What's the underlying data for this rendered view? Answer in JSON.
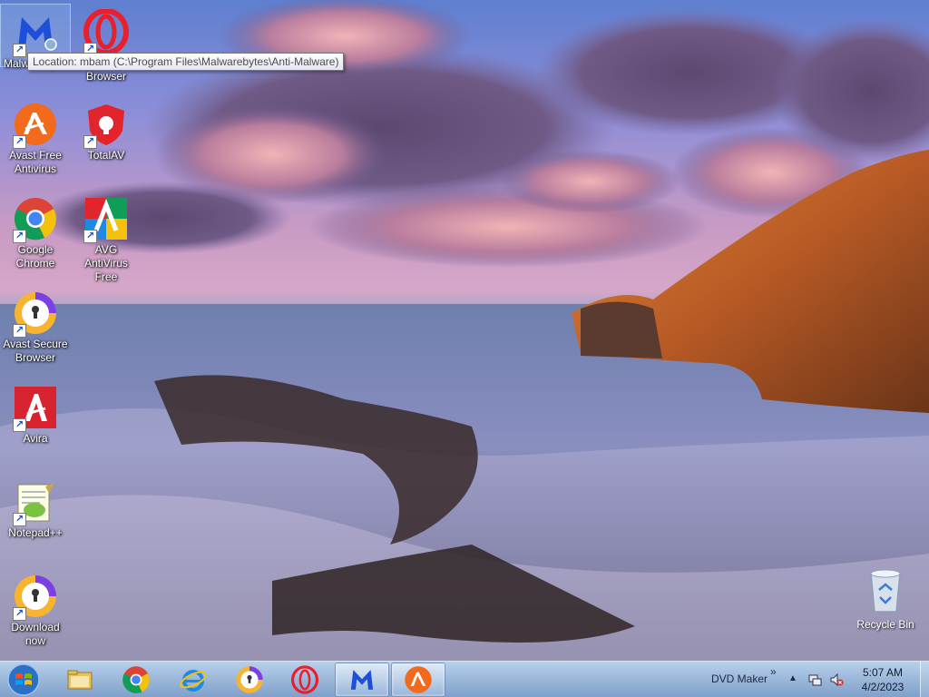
{
  "desktop": {
    "icons": [
      {
        "id": "malwarebytes",
        "label": "Malwarebytes",
        "icon": "malwarebytes-icon",
        "selected": true
      },
      {
        "id": "opera",
        "label": "Opera Browser",
        "icon": "opera-icon"
      },
      {
        "id": "avast-free",
        "label": "Avast Free Antivirus",
        "icon": "avast-icon"
      },
      {
        "id": "totalav",
        "label": "TotalAV",
        "icon": "totalav-icon"
      },
      {
        "id": "chrome",
        "label": "Google Chrome",
        "icon": "chrome-icon"
      },
      {
        "id": "avg",
        "label": "AVG AntiVirus Free",
        "icon": "avg-icon"
      },
      {
        "id": "avast-secure",
        "label": "Avast Secure Browser",
        "icon": "avast-secure-browser-icon"
      },
      {
        "id": "avira",
        "label": "Avira",
        "icon": "avira-icon"
      },
      {
        "id": "notepadpp",
        "label": "Notepad++",
        "icon": "notepadpp-icon"
      },
      {
        "id": "download",
        "label": "Download now",
        "icon": "download-now-icon"
      }
    ],
    "recycle_bin": {
      "label": "Recycle Bin",
      "icon": "recycle-bin-icon"
    },
    "tooltip": "Location: mbam (C:\\Program Files\\Malwarebytes\\Anti-Malware)",
    "shortcut_glyph": "↗"
  },
  "taskbar": {
    "start_icon": "windows-start-icon",
    "pinned": [
      {
        "id": "explorer",
        "icon": "file-explorer-icon"
      },
      {
        "id": "chrome",
        "icon": "chrome-icon"
      },
      {
        "id": "ie",
        "icon": "internet-explorer-icon"
      },
      {
        "id": "avast-secure",
        "icon": "avast-secure-browser-icon"
      },
      {
        "id": "opera",
        "icon": "opera-icon"
      },
      {
        "id": "malwarebytes",
        "icon": "malwarebytes-icon",
        "active": true
      },
      {
        "id": "avast",
        "icon": "avast-icon"
      }
    ],
    "toolbar_label": "DVD Maker",
    "toolbar_chevron": "»",
    "tray_arrow": "▲",
    "tray_icons": [
      "network-icon",
      "volume-muted-icon"
    ],
    "clock": {
      "time": "5:07 AM",
      "date": "4/2/2023"
    }
  },
  "colors": {
    "malwarebytes_blue": "#1e4fd8",
    "opera_red": "#e8202e",
    "avast_orange": "#f26a1b",
    "totalav_red": "#e2242c",
    "avira_red": "#d7232f"
  }
}
